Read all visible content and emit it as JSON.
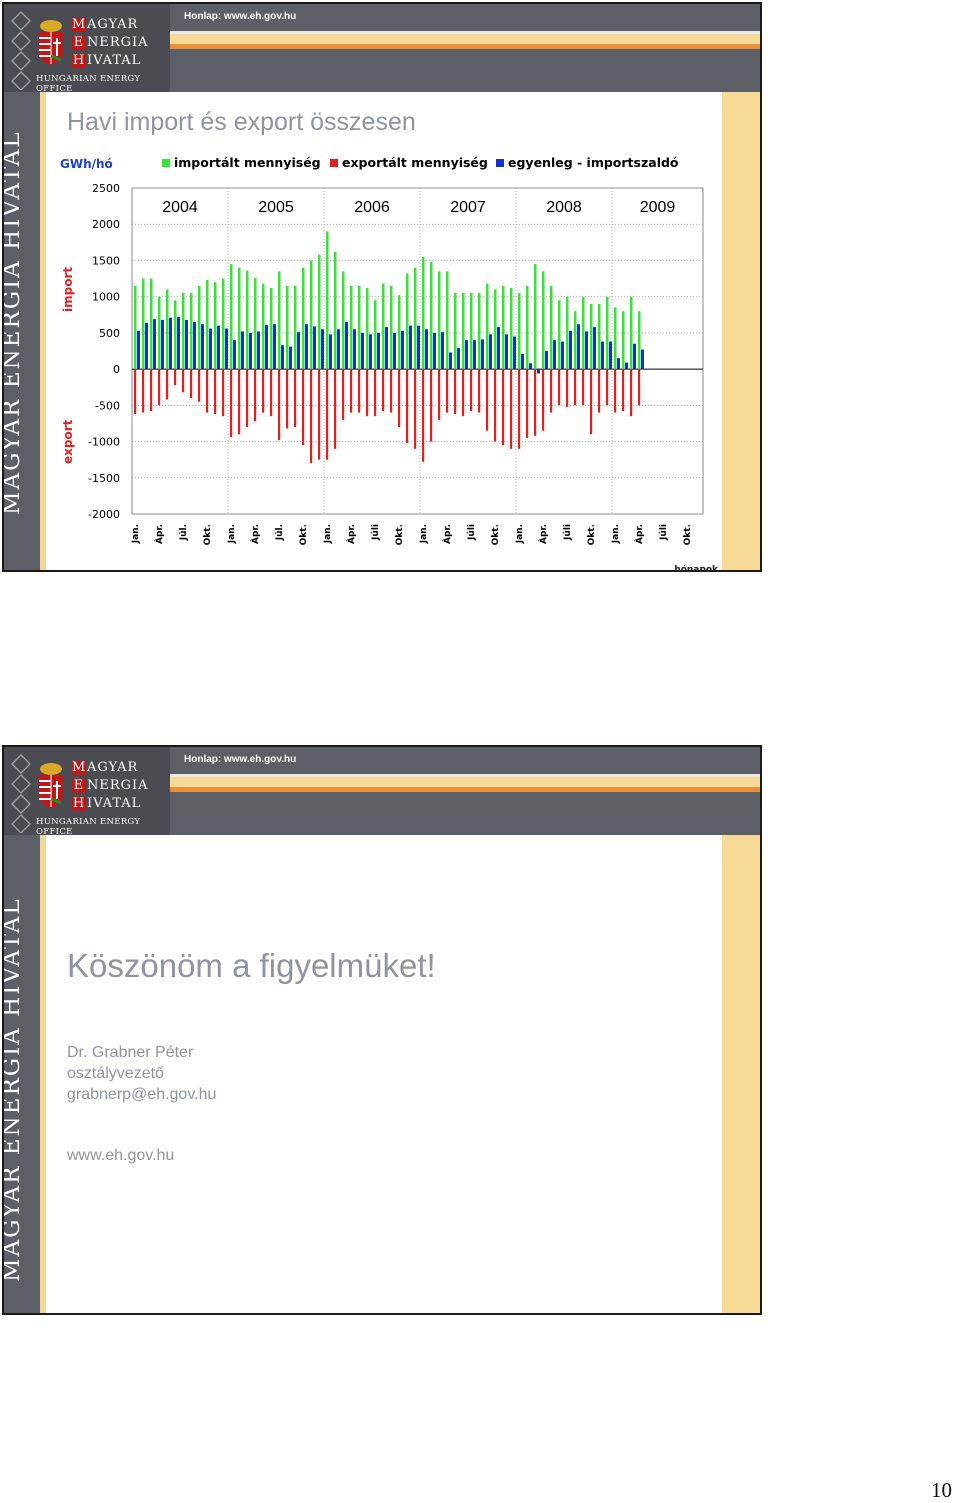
{
  "header": {
    "logo_line1": [
      "M",
      "AGYAR"
    ],
    "logo_line2": [
      "E",
      "NERGIA"
    ],
    "logo_line3": [
      "H",
      "IVATAL"
    ],
    "logo_sub": "HUNGARIAN ENERGY OFFICE",
    "homepage": "Honlap: www.eh.gov.hu",
    "side_text": "MAGYAR ENERGIA HIVATAL"
  },
  "slide1": {
    "title": "Havi import és export összesen"
  },
  "colors": {
    "import": "#33e633",
    "export": "#e02020",
    "balance": "#1530c8"
  },
  "chart_data": {
    "type": "bar",
    "unit_label": "GWh/hó",
    "ylabel_top": "import",
    "ylabel_bottom": "export",
    "xlabel": "hónapok",
    "ylim": [
      -2000,
      2500
    ],
    "yticks": [
      "2500",
      "2000",
      "1500",
      "1000",
      "500",
      "0",
      "-500",
      "-1000",
      "-1500",
      "-2000"
    ],
    "years": [
      "2004",
      "2005",
      "2006",
      "2007",
      "2008",
      "2009"
    ],
    "month_labels": [
      "Jan.",
      "Ápr.",
      "Júl.",
      "Okt.",
      "Jan.",
      "Ápr.",
      "Júl.",
      "Okt.",
      "Jan.",
      "Ápr.",
      "Júli",
      "Okt.",
      "Jan.",
      "Ápr.",
      "Júli",
      "Okt.",
      "Jan.",
      "Ápr.",
      "Júli",
      "Okt.",
      "Jan.",
      "Ápr.",
      "Júli",
      "Okt."
    ],
    "series": [
      {
        "name": "importált mennyiség",
        "color": "#33e633",
        "values": [
          1150,
          1250,
          1250,
          1000,
          1100,
          950,
          1050,
          1050,
          1150,
          1230,
          1200,
          1250,
          1450,
          1400,
          1360,
          1260,
          1180,
          1120,
          1350,
          1150,
          1150,
          1400,
          1500,
          1580,
          1900,
          1620,
          1350,
          1150,
          1150,
          1120,
          950,
          1180,
          1150,
          1020,
          1320,
          1400,
          1550,
          1480,
          1350,
          1350,
          1050,
          1050,
          1050,
          1050,
          1180,
          1100,
          1150,
          1120,
          1050,
          1150,
          1450,
          1350,
          1150,
          950,
          1000,
          800,
          1000,
          900,
          900,
          1000,
          850,
          800,
          1000,
          800
        ]
      },
      {
        "name": "exportált mennyiség",
        "color": "#e02020",
        "values": [
          -620,
          -600,
          -580,
          -500,
          -420,
          -220,
          -320,
          -400,
          -450,
          -600,
          -620,
          -650,
          -940,
          -900,
          -800,
          -720,
          -600,
          -650,
          -980,
          -820,
          -800,
          -1050,
          -1300,
          -1250,
          -1250,
          -1100,
          -700,
          -600,
          -600,
          -650,
          -650,
          -580,
          -600,
          -800,
          -1020,
          -1100,
          -1280,
          -1000,
          -700,
          -600,
          -620,
          -650,
          -580,
          -600,
          -850,
          -1000,
          -1050,
          -1100,
          -1100,
          -950,
          -920,
          -850,
          -600,
          -500,
          -520,
          -500,
          -500,
          -900,
          -600,
          -500,
          -600,
          -580,
          -650,
          -500
        ]
      },
      {
        "name": "egyenleg - importszaldó",
        "color": "#1530c8",
        "values": [
          530,
          640,
          690,
          680,
          710,
          720,
          680,
          650,
          620,
          560,
          600,
          560,
          400,
          520,
          500,
          520,
          610,
          620,
          330,
          310,
          510,
          620,
          590,
          550,
          480,
          550,
          650,
          550,
          500,
          480,
          500,
          580,
          500,
          530,
          600,
          600,
          550,
          500,
          510,
          230,
          290,
          400,
          400,
          410,
          480,
          580,
          480,
          450,
          210,
          80,
          -60,
          250,
          400,
          380,
          530,
          620,
          520,
          580,
          380,
          380,
          150,
          90,
          350,
          270
        ]
      }
    ]
  },
  "slide2": {
    "title": "Köszönöm a figyelmüket!",
    "name": "Dr. Grabner Péter",
    "position": "osztályvezető",
    "email": "grabnerp@eh.gov.hu",
    "website": "www.eh.gov.hu"
  },
  "page_number": "10"
}
